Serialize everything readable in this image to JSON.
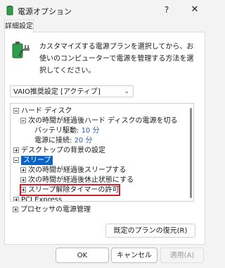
{
  "window": {
    "title": "電源オプション",
    "help": "?",
    "close": "✕"
  },
  "tab": {
    "label": "詳細設定"
  },
  "description": "カスタマイズする電源プランを選択してから、お使いのコンピューターで電源を管理する方法を選択してください。",
  "plan_select": {
    "value": "VAIO推奨設定 [アクティブ]"
  },
  "tree": {
    "hard_disk": "ハード ディスク",
    "turn_off_after": "次の時間が経過後ハード ディスクの電源を切る",
    "battery": "バッテリ駆動:",
    "battery_value": "10 分",
    "plugged": "電源に接続:",
    "plugged_value": "20 分",
    "desktop_bg": "デスクトップの背景の設定",
    "sleep": "スリープ",
    "sleep_after": "次の時間が経過後スリープする",
    "hibernate_after": "次の時間が経過後休止状態にする",
    "allow_wake_timers": "スリープ解除タイマーの許可",
    "pci_express": "PCI Express",
    "processor_power": "プロセッサの電源管理"
  },
  "buttons": {
    "restore": "既定のプランの復元(R)",
    "ok": "OK",
    "cancel": "キャンセル",
    "apply": "適用(A)"
  },
  "colors": {
    "selection": "#0a64c8",
    "value_text": "#2a5db0",
    "highlight_border": "#d21e2b"
  }
}
